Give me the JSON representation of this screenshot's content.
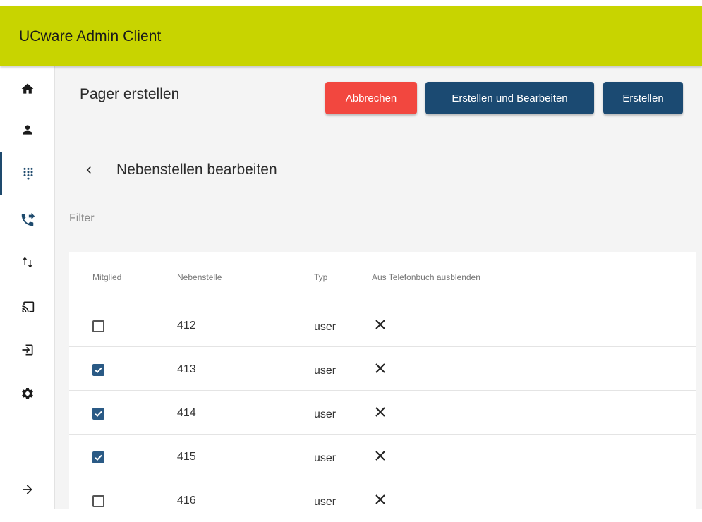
{
  "app": {
    "title": "UCware Admin Client"
  },
  "sidebar": {
    "items": [
      {
        "icon": "home-icon",
        "active": false
      },
      {
        "icon": "person-icon",
        "active": false
      },
      {
        "icon": "dialpad-icon",
        "active": true
      },
      {
        "icon": "phone-forward-icon",
        "active": false
      },
      {
        "icon": "swap-vert-icon",
        "active": false
      },
      {
        "icon": "cast-icon",
        "active": false
      },
      {
        "icon": "login-icon",
        "active": false
      },
      {
        "icon": "gear-icon",
        "active": false
      }
    ],
    "collapse_icon": "arrow-right-icon"
  },
  "header": {
    "title": "Pager erstellen",
    "cancel_label": "Abbrechen",
    "create_edit_label": "Erstellen und Bearbeiten",
    "create_label": "Erstellen"
  },
  "section": {
    "title": "Nebenstellen bearbeiten",
    "back_icon": "chevron-left-icon"
  },
  "filter": {
    "placeholder": "Filter",
    "value": ""
  },
  "table": {
    "columns": [
      "Mitglied",
      "Nebenstelle",
      "Typ",
      "Aus Telefonbuch ausblenden"
    ],
    "rows": [
      {
        "member": false,
        "extension": "412",
        "type": "user",
        "hidden_icon": "x-icon"
      },
      {
        "member": true,
        "extension": "413",
        "type": "user",
        "hidden_icon": "x-icon"
      },
      {
        "member": true,
        "extension": "414",
        "type": "user",
        "hidden_icon": "x-icon"
      },
      {
        "member": true,
        "extension": "415",
        "type": "user",
        "hidden_icon": "x-icon"
      },
      {
        "member": false,
        "extension": "416",
        "type": "user",
        "hidden_icon": "x-icon"
      }
    ]
  },
  "colors": {
    "topbar": "#c8d400",
    "primary": "#1b4a72",
    "danger": "#f2473f",
    "checkbox": "#2a5a85",
    "content_bg": "#f4f4f4"
  }
}
